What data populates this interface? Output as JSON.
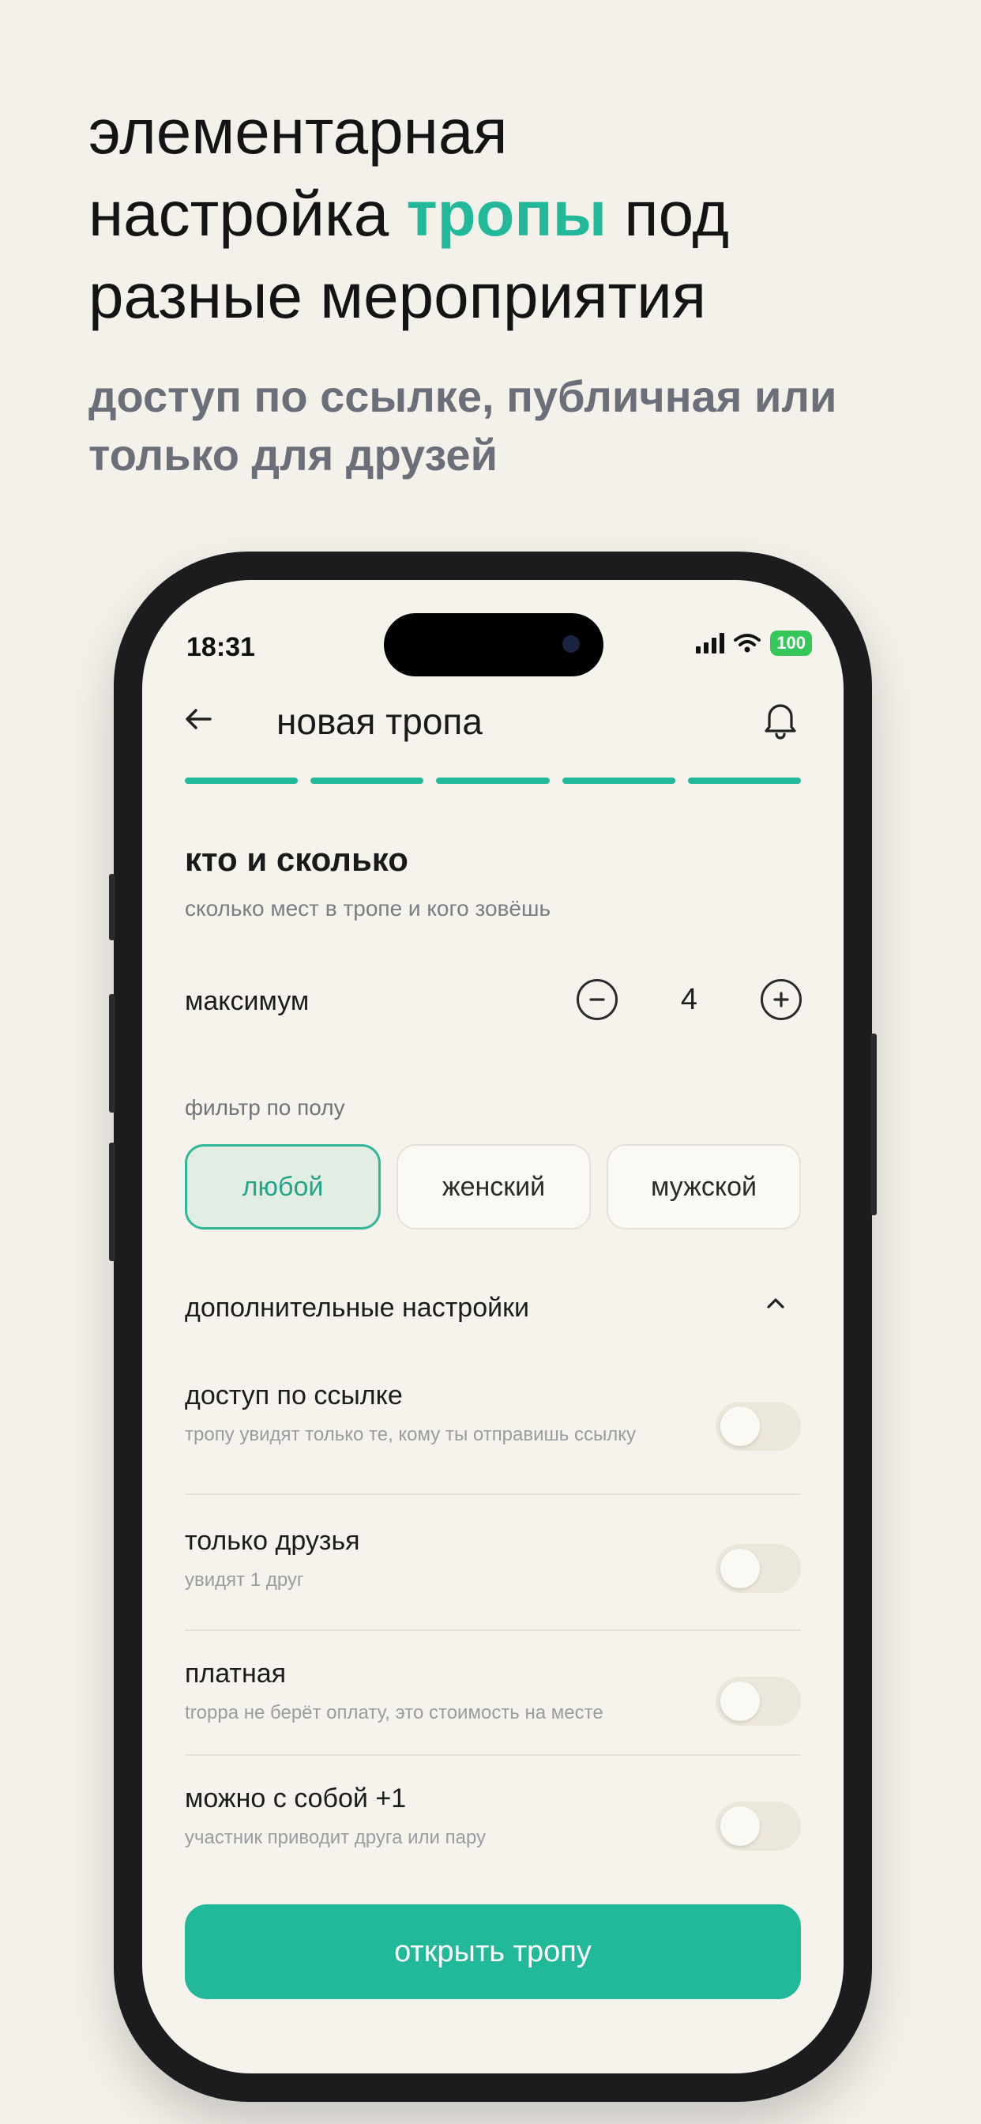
{
  "promo": {
    "headline_line1": "элементарная",
    "headline_line2_pre": "настройка",
    "headline_accent": "тропы",
    "headline_line2_post": "под",
    "headline_line3": "разные мероприятия",
    "subheadline": "доступ по ссылке, публичная или только для друзей",
    "accent_color": "#22b99a"
  },
  "status_bar": {
    "time": "18:31",
    "battery": "100"
  },
  "appbar": {
    "title": "новая тропа",
    "back_icon": "arrow-left-icon",
    "notification_icon": "bell-icon"
  },
  "progress": {
    "total_steps": 5,
    "completed_steps": 5
  },
  "section": {
    "title": "кто и сколько",
    "subtitle": "сколько мест в тропе и кого зовёшь"
  },
  "maximum": {
    "label": "максимум",
    "value": "4",
    "minus_icon": "minus-circle-icon",
    "plus_icon": "plus-circle-icon"
  },
  "gender_filter": {
    "label": "фильтр по полу",
    "options": [
      {
        "label": "любой",
        "selected": true
      },
      {
        "label": "женский",
        "selected": false
      },
      {
        "label": "мужской",
        "selected": false
      }
    ]
  },
  "advanced": {
    "label": "дополнительные настройки",
    "chevron_icon": "chevron-up-icon",
    "toggles": [
      {
        "title": "доступ по ссылке",
        "description": "тропу увидят только те, кому ты отправишь ссылку",
        "on": false
      },
      {
        "title": "только друзья",
        "description": "увидят 1 друг",
        "on": false
      },
      {
        "title": "платная",
        "description": "troppa не берёт оплату, это стоимость на месте",
        "on": false
      },
      {
        "title": "можно с собой +1",
        "description": "участник приводит друга или пару",
        "on": false
      }
    ]
  },
  "cta": {
    "label": "открыть тропу"
  }
}
